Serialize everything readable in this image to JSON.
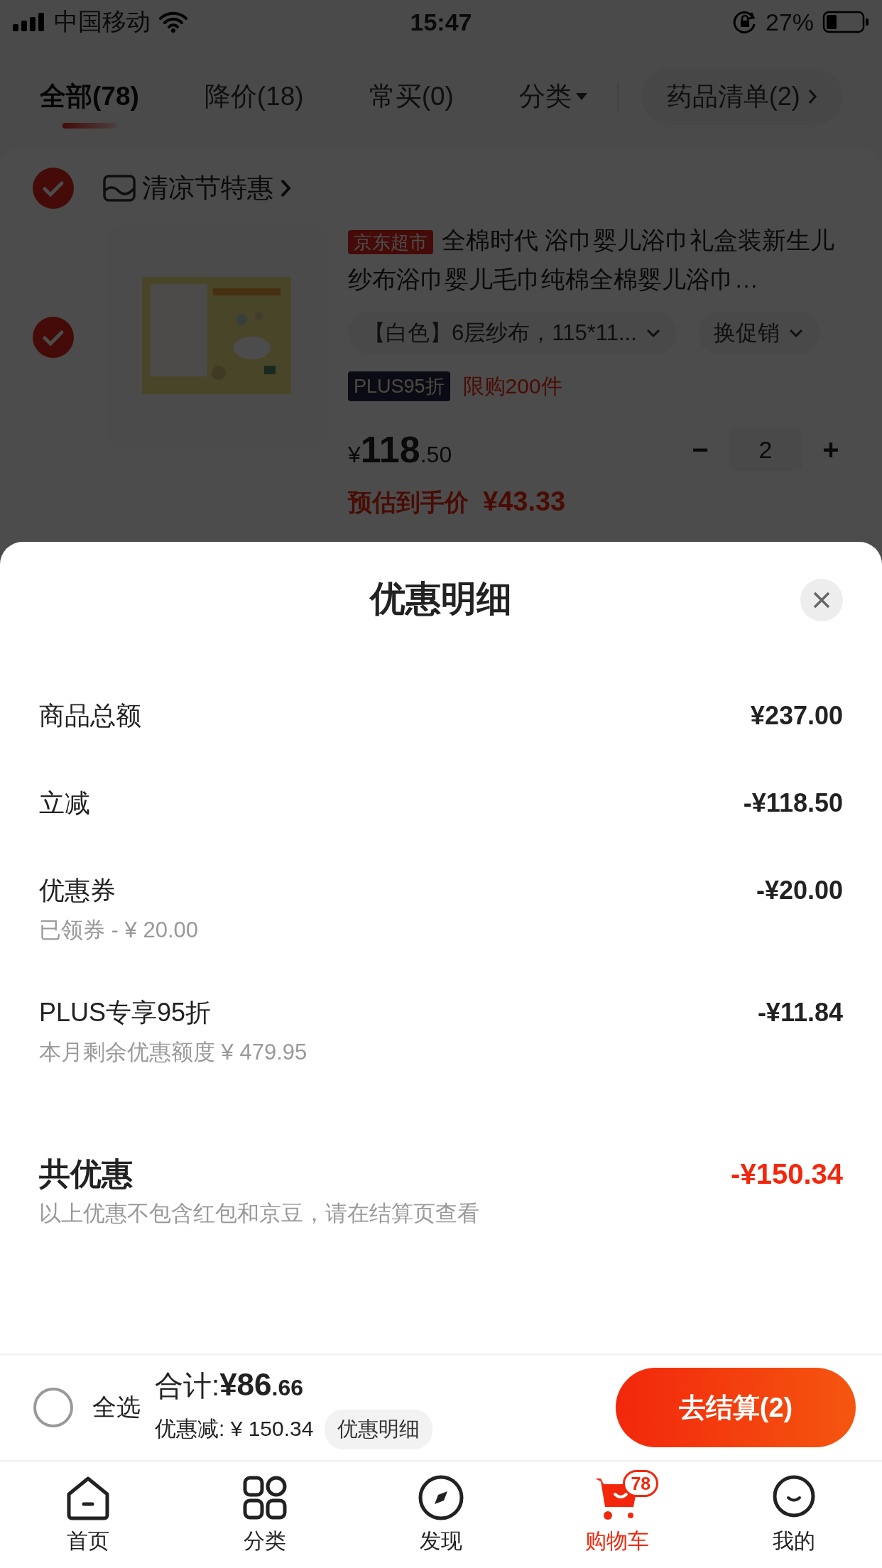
{
  "status_bar": {
    "carrier": "中国移动",
    "time": "15:47",
    "battery": "27%"
  },
  "tabs": [
    {
      "label": "全部(78)",
      "selected": true,
      "kind": "plain"
    },
    {
      "label": "降价(18)",
      "selected": false,
      "kind": "plain"
    },
    {
      "label": "常买(0)",
      "selected": false,
      "kind": "plain"
    },
    {
      "label": "分类",
      "selected": false,
      "kind": "dropdown"
    }
  ],
  "list_button": "药品清单(2)",
  "store": {
    "checked": true,
    "name": "清凉节特惠"
  },
  "product": {
    "checked": true,
    "badge": "京东超市",
    "title": "全棉时代 浴巾婴儿浴巾礼盒装新生儿纱布浴巾婴儿毛巾纯棉全棉婴儿浴巾…",
    "spec": "【白色】6层纱布，115*11...",
    "promo": "换促销",
    "plus_tag": "PLUS95折",
    "limit": "限购200件",
    "price": {
      "currency": "¥",
      "integer": "118",
      "decimal": ".50"
    },
    "quantity": "2",
    "minus": "−",
    "plus": "+",
    "estimate_label": "预估到手价",
    "estimate_price": "¥43.33"
  },
  "sheet": {
    "title": "优惠明细",
    "rows": [
      {
        "label": "商品总额",
        "amount": "¥237.00"
      },
      {
        "label": "立减",
        "amount": "-¥118.50"
      },
      {
        "label": "优惠券",
        "amount": "-¥20.00",
        "note": "已领券 - ¥ 20.00"
      },
      {
        "label": "PLUS专享95折",
        "amount": "-¥11.84",
        "note": "本月剩余优惠额度 ¥ 479.95"
      }
    ],
    "total": {
      "label": "共优惠",
      "amount": "-¥150.34",
      "note": "以上优惠不包含红包和京豆，请在结算页查看"
    }
  },
  "checkout": {
    "select_all": {
      "checked": false,
      "label": "全选"
    },
    "total_label": "合计:",
    "total": {
      "currency": "¥",
      "integer": "86",
      "decimal": ".66"
    },
    "discount": "优惠减: ¥ 150.34",
    "detail_button": "优惠明细",
    "checkout_button": "去结算(2)"
  },
  "nav": [
    {
      "kind": "home",
      "label": "首页",
      "selected": false
    },
    {
      "kind": "grid",
      "label": "分类",
      "selected": false
    },
    {
      "kind": "compass",
      "label": "发现",
      "selected": false
    },
    {
      "kind": "cart",
      "label": "购物车",
      "selected": true,
      "badge": "78"
    },
    {
      "kind": "face",
      "label": "我的",
      "selected": false
    }
  ]
}
